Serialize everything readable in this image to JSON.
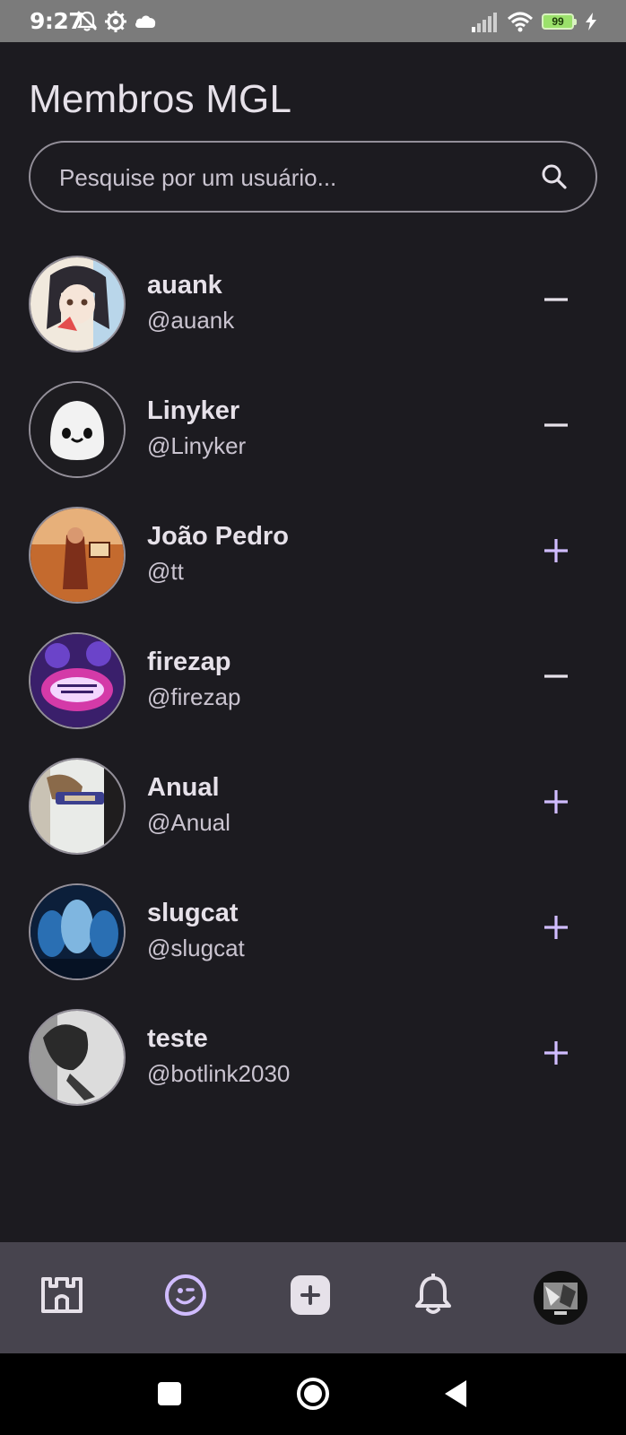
{
  "status_bar": {
    "time": "9:27",
    "battery": "99",
    "icons": [
      "notifications-off-icon",
      "settings-gear-icon",
      "cloud-icon",
      "signal-icon",
      "wifi-icon",
      "battery-icon",
      "charging-icon"
    ]
  },
  "header": {
    "title": "Membros MGL"
  },
  "search": {
    "placeholder": "Pesquise por um usuário...",
    "icon": "search-icon"
  },
  "members": [
    {
      "name": "auank",
      "handle": "@auank",
      "action": "remove",
      "avatar_colors": [
        "#f1e9dd",
        "#2d2a32",
        "#b9d6ea"
      ]
    },
    {
      "name": "Linyker",
      "handle": "@Linyker",
      "action": "remove",
      "avatar_colors": [
        "#1d1c20",
        "#f2f2f2",
        "#111111"
      ]
    },
    {
      "name": "João Pedro",
      "handle": "@tt",
      "action": "add",
      "avatar_colors": [
        "#c46a2e",
        "#7d2f1a",
        "#e7b07a"
      ]
    },
    {
      "name": "firezap",
      "handle": "@firezap",
      "action": "remove",
      "avatar_colors": [
        "#3a1f6b",
        "#d43aa8",
        "#6b44c9"
      ]
    },
    {
      "name": "Anual",
      "handle": "@Anual",
      "action": "add",
      "avatar_colors": [
        "#e9ebe8",
        "#8a6a4a",
        "#3b3f8e"
      ]
    },
    {
      "name": "slugcat",
      "handle": "@slugcat",
      "action": "add",
      "avatar_colors": [
        "#0c1f3a",
        "#2a6fb3",
        "#7fb6e0"
      ]
    },
    {
      "name": "teste",
      "handle": "@botlink2030",
      "action": "add",
      "avatar_colors": [
        "#dcdcdc",
        "#2a2a2a",
        "#9a9a9a"
      ]
    }
  ],
  "colors": {
    "background": "#1c1b20",
    "accent": "#d0bcff",
    "remove_icon": "#e6e1e9",
    "nav_bar": "#47444e"
  },
  "bottom_nav": {
    "items": [
      {
        "icon": "castle-icon",
        "active": false
      },
      {
        "icon": "community-face-icon",
        "active": true
      },
      {
        "icon": "add-post-icon",
        "active": false
      },
      {
        "icon": "bell-icon",
        "active": false
      },
      {
        "icon": "profile-avatar-icon",
        "active": false
      }
    ]
  },
  "system_nav": {
    "icons": [
      "recents-square-icon",
      "home-circle-icon",
      "back-triangle-icon"
    ]
  }
}
